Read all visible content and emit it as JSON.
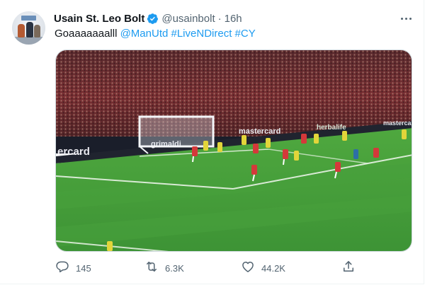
{
  "tweet": {
    "display_name": "Usain St. Leo Bolt",
    "handle": "@usainbolt",
    "separator": "·",
    "timestamp": "16h",
    "text_plain": "Goaaaaaaalll ",
    "mentions": [
      "@ManUtd",
      "#LiveNDirect",
      "#CY"
    ],
    "verified": true
  },
  "media": {
    "type": "video",
    "ad_boards": [
      "ercard",
      "mastercard",
      "herbalife",
      "mastercard",
      "grimaldi"
    ]
  },
  "actions": {
    "reply_count": "145",
    "retweet_count": "6.3K",
    "like_count": "44.2K"
  },
  "icons": {
    "verified": "verified-badge-icon",
    "more": "more-dots-icon",
    "reply": "reply-icon",
    "retweet": "retweet-icon",
    "like": "heart-icon",
    "share": "share-icon"
  },
  "colors": {
    "link": "#1d9bf0",
    "muted": "#536471",
    "text": "#0f1419",
    "pitch": "#3f9a3a"
  }
}
